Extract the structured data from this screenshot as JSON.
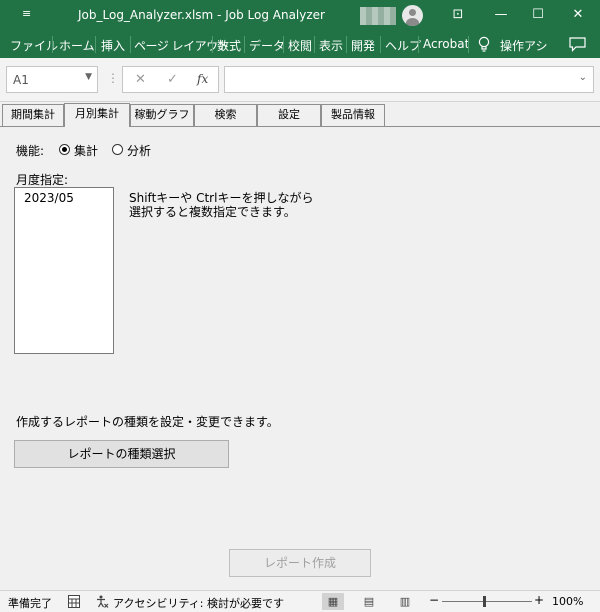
{
  "window": {
    "qat_icon": "≡",
    "title": "Job_Log_Analyzer.xlsm  -  Job Log Analyzer",
    "controls": {
      "ribbon_display": "⊡",
      "minimize": "—",
      "maximize": "☐",
      "close": "✕"
    }
  },
  "menu": [
    "ファイル",
    "ホーム",
    "挿入",
    "ページ レイアウト",
    "数式",
    "データ",
    "校閲",
    "表示",
    "開発",
    "ヘルプ",
    "Acrobat",
    "操作アシ"
  ],
  "menu_icons": {
    "tell_me": "tell-me-lightbulb-icon",
    "comments": "comments-icon"
  },
  "formula_bar": {
    "name_box": "A1",
    "cancel": "✕",
    "enter": "✓",
    "fx": "fx",
    "value": ""
  },
  "tabs": [
    "期間集計",
    "月別集計",
    "稼動グラフ",
    "検索",
    "設定",
    "製品情報"
  ],
  "active_tab": "月別集計",
  "form": {
    "function_label": "機能:",
    "options": [
      {
        "label": "集計",
        "selected": true
      },
      {
        "label": "分析",
        "selected": false
      }
    ],
    "month_label": "月度指定:",
    "months": [
      "2023/05"
    ],
    "hint_line1": "Shiftキーや Ctrlキーを押しながら",
    "hint_line2": "選択すると複数指定できます。",
    "report_desc": "作成するレポートの種類を設定・変更できます。",
    "report_type_button": "レポートの種類選択",
    "create_button": "レポート作成"
  },
  "status": {
    "ready": "準備完了",
    "accessibility": "アクセシビリティ: 検討が必要です",
    "zoom_minus": "−",
    "zoom_plus": "+",
    "zoom": "100%"
  },
  "colors": {
    "accent": "#217346",
    "dialog_bg": "#f0f0f0"
  }
}
